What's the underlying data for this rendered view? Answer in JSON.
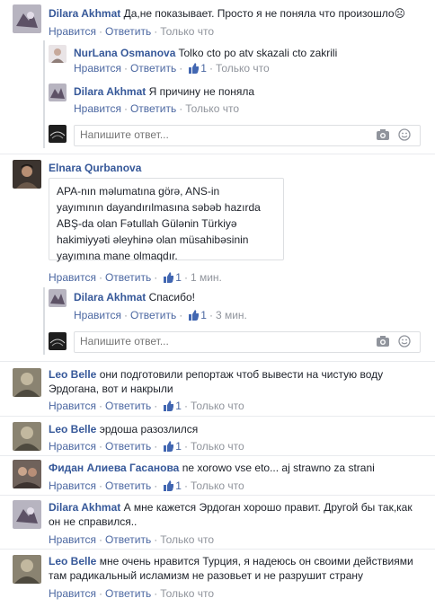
{
  "actions": {
    "like": "Нравится",
    "reply": "Ответить",
    "sep": "·"
  },
  "reply_placeholder": "Напишите ответ...",
  "comments": [
    {
      "name": "Dilara Akhmat",
      "text": "Да,не показывает. Просто я не поняла что произошло",
      "emoji": "☹",
      "meta": "Только что"
    },
    {
      "name": "NurLana Osmanova",
      "text": "Tolko cto po atv skazali cto zakrili",
      "likes": "1",
      "meta": "Только что"
    },
    {
      "name": "Dilara Akhmat",
      "text": "Я причину не поняла",
      "meta": "Только что"
    },
    {
      "name": "Elnara Qurbanova",
      "text_lines": [
        "APA-nın məlumatına görə, ANS-in",
        "yayımının dayandırılmasına səbəb hazırda",
        "ABŞ-da olan Fətullah Gülənin Türkiyə",
        "hakimiyyəti əleyhinə olan müsahibəsinin",
        "yayımına mane olmaqdır."
      ],
      "likes": "1",
      "meta": "1 мин."
    },
    {
      "name": "Dilara Akhmat",
      "text": "Спасибо!",
      "likes": "1",
      "meta": "3 мин."
    },
    {
      "name": "Leo Belle",
      "text": "они подготовили репортаж чтоб вывести на чистую воду",
      "text2": "Эрдогана, вот и накрыли",
      "likes": "1",
      "meta": "Только что"
    },
    {
      "name": "Leo Belle",
      "text": "эрдоша разозлился",
      "likes": "1",
      "meta": "Только что"
    },
    {
      "name": "Фидан Алиева Гасанова",
      "text": "ne xorowo vse eto... aj strawno za strani",
      "likes": "1",
      "meta": "Только что"
    },
    {
      "name": "Dilara Akhmat",
      "text": "А мне кажется Эрдоган хорошо правит. Другой бы так,как",
      "text2": "он не справился..",
      "meta": "Только что"
    },
    {
      "name": "Leo Belle",
      "text": "мне очень нравится Турция, я надеюсь он своими действиями",
      "text2": "там радикальный исламизм не разовьет и не разрушит страну",
      "meta": "Только что"
    }
  ]
}
